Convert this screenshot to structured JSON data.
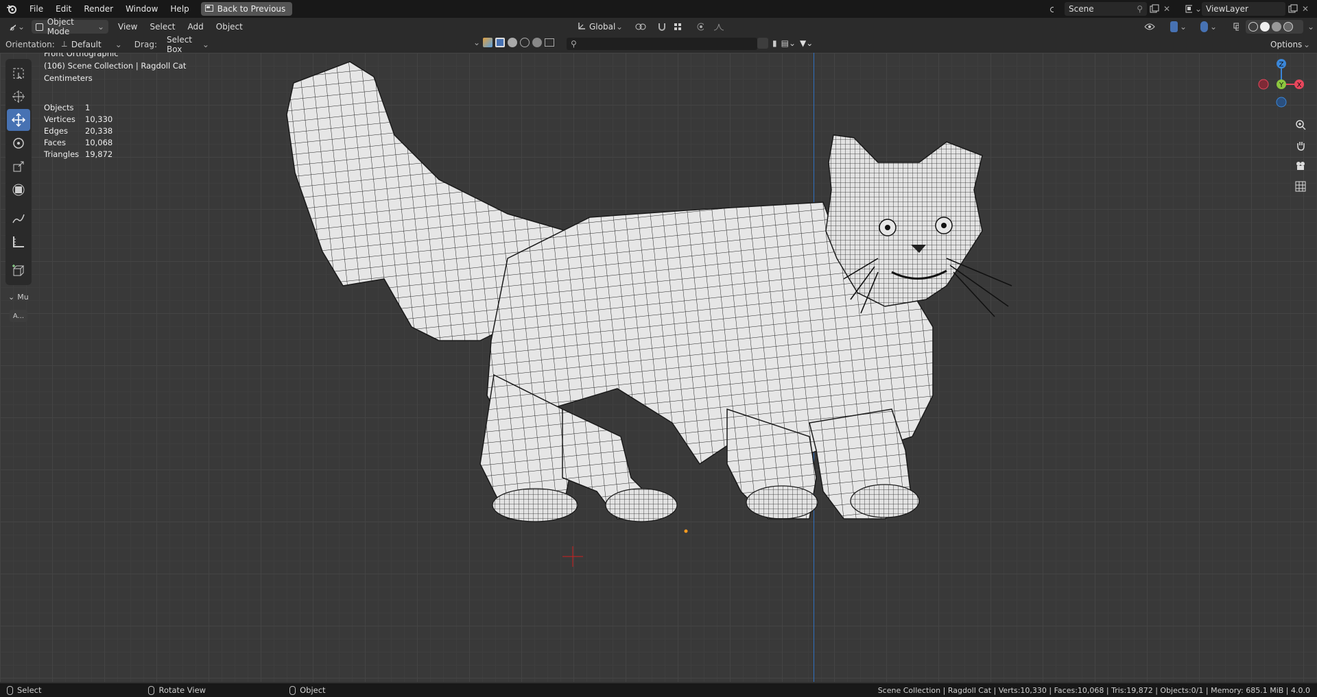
{
  "topbar": {
    "menus": [
      "File",
      "Edit",
      "Render",
      "Window",
      "Help"
    ],
    "back_label": "Back to Previous",
    "scene_name": "Scene",
    "view_layer": "ViewLayer"
  },
  "header": {
    "mode": "Object Mode",
    "menus": [
      "View",
      "Select",
      "Add",
      "Object"
    ],
    "transform_orientation": "Global",
    "options_label": "Options"
  },
  "subheader": {
    "orientation_label": "Orientation:",
    "orientation_value": "Default",
    "drag_label": "Drag:",
    "drag_value": "Select Box",
    "search_placeholder": ""
  },
  "viewport_info": {
    "view_name": "Front Orthographic",
    "collection_line": "(106) Scene Collection | Ragdoll Cat",
    "units": "Centimeters"
  },
  "stats": [
    {
      "label": "Objects",
      "value": "1"
    },
    {
      "label": "Vertices",
      "value": "10,330"
    },
    {
      "label": "Edges",
      "value": "20,338"
    },
    {
      "label": "Faces",
      "value": "10,068"
    },
    {
      "label": "Triangles",
      "value": "19,872"
    }
  ],
  "toolbar_panel": {
    "collapsed_label": "Mu",
    "apply_label": "A..."
  },
  "gizmo": {
    "z": "Z",
    "y": "Y",
    "x": "X"
  },
  "statusbar": {
    "select": "Select",
    "rotate": "Rotate View",
    "object": "Object",
    "right_info": "Scene Collection | Ragdoll Cat | Verts:10,330 | Faces:10,068 | Tris:19,872 | Objects:0/1 | Memory: 685.1 MiB | 4.0.0"
  },
  "colors": {
    "accent": "#4772b3",
    "x_axis": "#e8465c",
    "y_axis": "#8cc63f",
    "z_axis": "#3a86d8"
  }
}
